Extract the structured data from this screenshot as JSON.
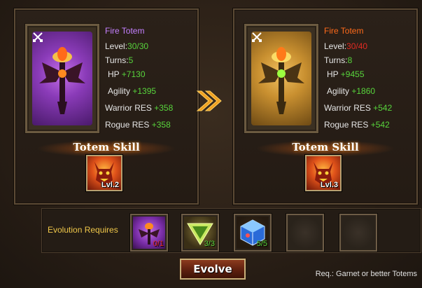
{
  "left": {
    "name": "Fire Totem",
    "level_label": "Level:",
    "level_value": "30/30",
    "turns_label": "Turns:",
    "turns_value": "5",
    "hp_label": "HP",
    "hp_value": "+7130",
    "agility_label": "Agility",
    "agility_value": "+1395",
    "warrior_label": "Warrior RES",
    "warrior_value": "+358",
    "rogue_label": "Rogue RES",
    "rogue_value": "+358",
    "skill_title": "Totem Skill",
    "skill_level": "Lvl.2"
  },
  "right": {
    "name": "Fire Totem",
    "level_label": "Level:",
    "level_value": "30/40",
    "turns_label": "Turns:",
    "turns_value": "8",
    "hp_label": "HP",
    "hp_value": "+9455",
    "agility_label": "Agility",
    "agility_value": "+1860",
    "warrior_label": "Warrior RES",
    "warrior_value": "+542",
    "rogue_label": "Rogue RES",
    "rogue_value": "+542",
    "skill_title": "Totem Skill",
    "skill_level": "Lvl.3"
  },
  "requirements": {
    "label": "Evolution Requires",
    "slots": [
      {
        "item": "fire-totem",
        "count": "0/1",
        "count_color": "#e22a22"
      },
      {
        "item": "green-triangle-gem",
        "count": "3/3",
        "count_color": "#58d43c"
      },
      {
        "item": "blue-cube-gem",
        "count": "5/5",
        "count_color": "#58d43c"
      }
    ]
  },
  "evolve_button": "Evolve",
  "note": "Req.: Garnet or better Totems",
  "colors": {
    "green": "#58d43c",
    "red": "#e22a22",
    "purple_name": "#c480ff",
    "orange_name": "#ff6a1a",
    "gold_label": "#f0c84a"
  }
}
